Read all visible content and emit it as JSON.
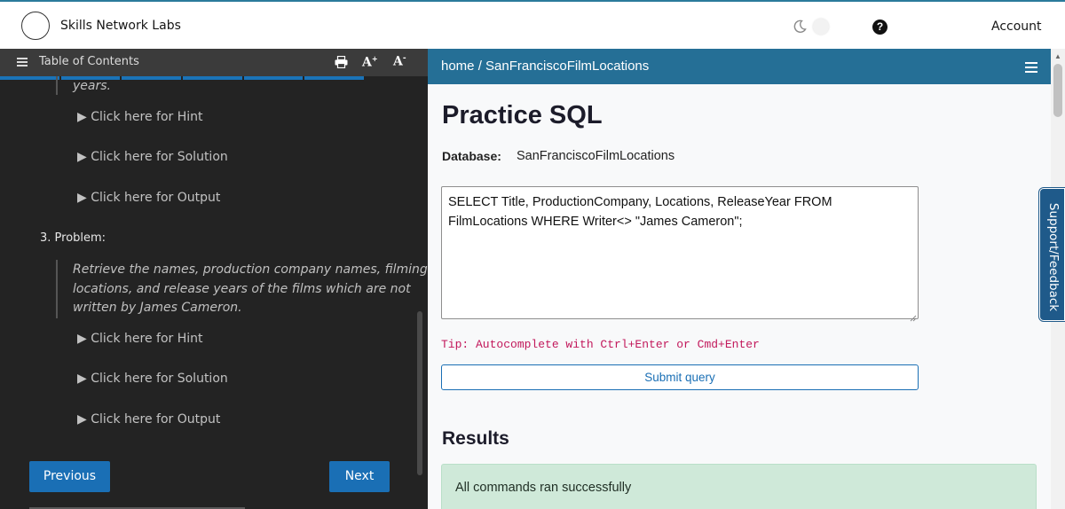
{
  "header": {
    "brand": "Skills Network Labs",
    "account": "Account",
    "icons": {
      "logo": "logo-circle",
      "theme": "moon-icon",
      "help": "help-icon"
    }
  },
  "left_panel": {
    "toc_label": "Table of Contents",
    "font_increase": "A+",
    "font_decrease": "A-",
    "previous_italic_tail": "years.",
    "details_1": [
      "▶ Click here for Hint",
      "▶ Click here for Solution",
      "▶ Click here for Output"
    ],
    "problem_heading": "3. Problem:",
    "problem_lines": [
      "Retrieve the names, production company names, filming",
      "locations, and release years of the films which are not",
      "written by James Cameron."
    ],
    "details_2": [
      "▶ Click here for Hint",
      "▶ Click here for Solution",
      "▶ Click here for Output"
    ],
    "previous_button": "Previous",
    "next_button": "Next"
  },
  "right_panel": {
    "breadcrumb": "home / SanFranciscoFilmLocations",
    "title": "Practice SQL",
    "database_label": "Database:",
    "database_value": "SanFranciscoFilmLocations",
    "query_lines": [
      "SELECT Title, ProductionCompany, Locations, ReleaseYear FROM",
      "FilmLocations WHERE Writer<> \"James Cameron\";"
    ],
    "tip": "Tip: Autocomplete with Ctrl+Enter or Cmd+Enter",
    "submit_label": "Submit query",
    "results_heading": "Results",
    "success_message": "All commands ran successfully"
  },
  "support_tab": "Support/Feedback",
  "colors": {
    "accent": "#1a6fb5",
    "header_blue": "#256f96",
    "left_bg": "#232323",
    "success_bg": "#cfe9d9",
    "tip": "#c2185b"
  }
}
